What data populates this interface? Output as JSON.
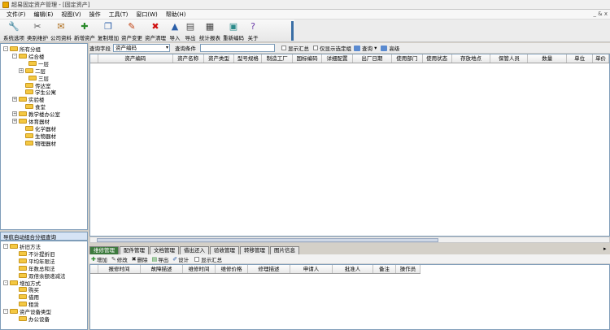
{
  "window": {
    "title": "超易固定资产管理 - [固定资产]"
  },
  "menu": {
    "items": [
      "文件(F)",
      "编辑(E)",
      "视图(V)",
      "操作",
      "工具(T)",
      "窗口(W)",
      "帮助(H)"
    ],
    "right_glyph": "_ & x"
  },
  "toolbar": {
    "buttons": [
      {
        "label": "系统选项",
        "icon": "settings-icon",
        "glyph": "🔧",
        "color": "#c88a00"
      },
      {
        "label": "类别维护",
        "icon": "tools-icon",
        "glyph": "✂",
        "color": "#555555"
      },
      {
        "label": "公司资料",
        "icon": "company-icon",
        "glyph": "✉",
        "color": "#b07020"
      },
      {
        "label": "新增资产",
        "icon": "add-asset-icon",
        "glyph": "✚",
        "color": "#2a8a2a"
      },
      {
        "label": "复制增加",
        "icon": "copy-icon",
        "glyph": "❐",
        "color": "#2a5ea8"
      },
      {
        "label": "资产变更",
        "icon": "edit-pen-icon",
        "glyph": "✎",
        "color": "#c04010"
      },
      {
        "label": "资产清理",
        "icon": "delete-x-icon",
        "glyph": "✖",
        "color": "#d01010"
      },
      {
        "label": "导入",
        "icon": "import-icon",
        "glyph": "▲",
        "color": "#2a5ea8"
      },
      {
        "label": "导出",
        "icon": "export-icon",
        "glyph": "▤",
        "color": "#505050"
      },
      {
        "label": "统计报表",
        "icon": "report-icon",
        "glyph": "▦",
        "color": "#404040"
      },
      {
        "label": "重新编码",
        "icon": "recode-icon",
        "glyph": "▣",
        "color": "#2a8a8a"
      },
      {
        "label": "关于",
        "icon": "help-icon",
        "glyph": "?",
        "color": "#6a3aa8"
      }
    ]
  },
  "tree_top": {
    "nodes": [
      {
        "label": "所有分组",
        "exp": "-"
      },
      {
        "label": "综合楼",
        "exp": "-"
      },
      {
        "label": "一层",
        "exp": ""
      },
      {
        "label": "二层",
        "exp": "+"
      },
      {
        "label": "三层",
        "exp": ""
      },
      {
        "label": "传达室",
        "exp": ""
      },
      {
        "label": "学生公寓",
        "exp": ""
      },
      {
        "label": "实验楼",
        "exp": "+"
      },
      {
        "label": "食堂",
        "exp": ""
      },
      {
        "label": "教学楼办公室",
        "exp": "+"
      },
      {
        "label": "体育器材",
        "exp": "+"
      },
      {
        "label": "化学器材",
        "exp": ""
      },
      {
        "label": "生物器材",
        "exp": ""
      },
      {
        "label": "物理器材",
        "exp": ""
      }
    ]
  },
  "tree_bottom": {
    "title": "导航自动组合分组查询",
    "nodes": [
      {
        "label": "折旧方法",
        "exp": "-"
      },
      {
        "label": "不计提折旧",
        "exp": ""
      },
      {
        "label": "平均年限法",
        "exp": ""
      },
      {
        "label": "年数总和法",
        "exp": ""
      },
      {
        "label": "双倍余额递减法",
        "exp": ""
      },
      {
        "label": "增加方式",
        "exp": "-"
      },
      {
        "label": "购买",
        "exp": ""
      },
      {
        "label": "借用",
        "exp": ""
      },
      {
        "label": "租赁",
        "exp": ""
      },
      {
        "label": "资产设备类型",
        "exp": "-"
      },
      {
        "label": "办公设备",
        "exp": ""
      }
    ]
  },
  "query": {
    "field_label": "查询字段",
    "field_value": "资产编码",
    "cond_label": "查询条件",
    "show_summary": "显示汇总",
    "only_selected": "仅显示选定组",
    "search_btn": "查询",
    "advanced_btn": "高级"
  },
  "main_grid": {
    "columns": [
      "资产编码",
      "资产名称",
      "资产类型",
      "型号规格",
      "制造工厂",
      "国标编码",
      "详细配置",
      "出厂日期",
      "使用部门",
      "使用状态",
      "存放地点",
      "保管人员",
      "数量",
      "单位",
      "单价"
    ]
  },
  "tabs": {
    "items": [
      "维修管理",
      "配件管理",
      "文档管理",
      "借出还入",
      "验收管理",
      "转移管理",
      "图片信息"
    ]
  },
  "sub_toolbar": {
    "add": "增加",
    "edit": "修改",
    "delete": "删除",
    "export": "导出",
    "design": "设计",
    "show_summary": "显示汇总"
  },
  "sub_grid": {
    "columns": [
      "报修时间",
      "故障描述",
      "维修时间",
      "维修价格",
      "修理描述",
      "申请人",
      "批准人",
      "备注",
      "操作员"
    ]
  }
}
